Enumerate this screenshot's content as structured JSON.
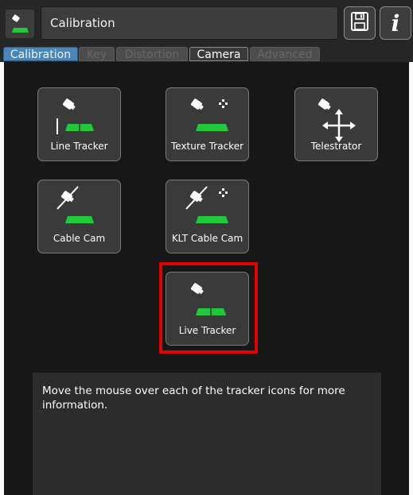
{
  "header": {
    "title": "Calibration",
    "app_icon": "camera-on-field-icon",
    "save_icon": "floppy-disk-icon",
    "info_icon": "info-icon",
    "info_glyph": "i"
  },
  "tabs": [
    {
      "label": "Calibration",
      "state": "selected"
    },
    {
      "label": "Key",
      "state": "disabled"
    },
    {
      "label": "Distortion",
      "state": "disabled"
    },
    {
      "label": "Camera",
      "state": "enabled"
    },
    {
      "label": "Advanced",
      "state": "disabled"
    }
  ],
  "trackers": [
    {
      "label": "Line Tracker",
      "icon": "line-tracker-icon"
    },
    {
      "label": "Texture Tracker",
      "icon": "texture-tracker-icon"
    },
    {
      "label": "Telestrator",
      "icon": "telestrator-icon"
    },
    {
      "label": "Cable Cam",
      "icon": "cable-cam-icon"
    },
    {
      "label": "KLT Cable Cam",
      "icon": "klt-cable-cam-icon"
    },
    {
      "label": "Live Tracker",
      "icon": "live-tracker-icon",
      "highlighted": true
    }
  ],
  "info_text": "Move the mouse over each of the tracker icons for more information.",
  "colors": {
    "field_green": "#22c93a",
    "highlight_red": "#e00000",
    "selected_tab_blue": "#4a87b8"
  }
}
